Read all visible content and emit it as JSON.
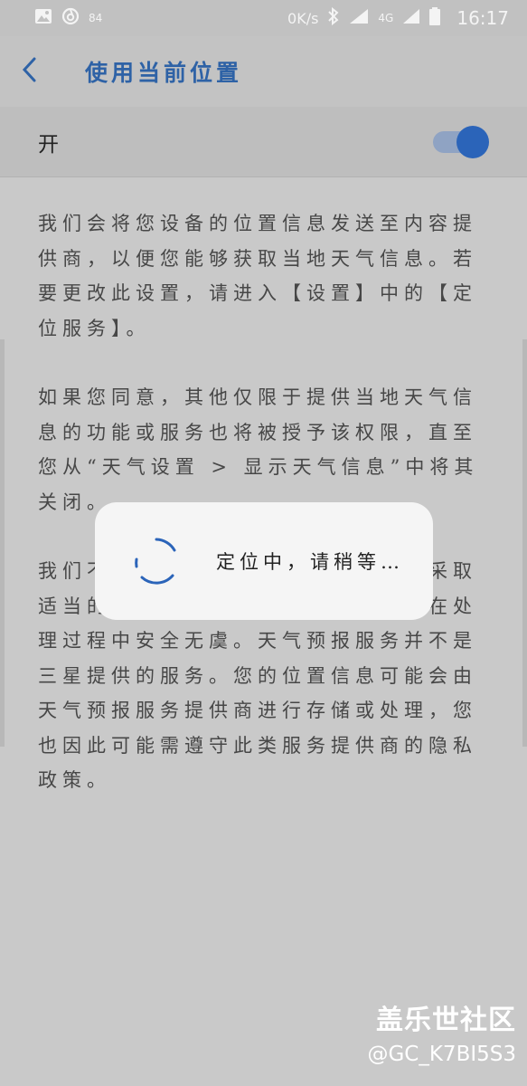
{
  "status_bar": {
    "notification_badge": "84",
    "network_speed": "0K/s",
    "network_type": "4G",
    "time": "16:17"
  },
  "header": {
    "title": "使用当前位置"
  },
  "switch": {
    "label": "开",
    "on": true
  },
  "body": {
    "paragraph1": "我们会将您设备的位置信息发送至内容提供商，以便您能够获取当地天气信息。若要更改此设置，请进入【设置】中的【定位服务】。",
    "paragraph2": "如果您同意，其他仅限于提供当地天气信息的功能或服务也将被授予该权限，直至您从“天气设置 > 显示天气信息”中将其关闭。",
    "paragraph3": "我们不会对您的信息进行保存，并将采取适当的安全措施，确保您的位置信息在处理过程中安全无虞。天气预报服务并不是三星提供的服务。您的位置信息可能会由天气预报服务提供商进行存储或处理，您也因此可能需遵守此类服务提供商的隐私政策。"
  },
  "dialog": {
    "message": "定位中，请稍等…"
  },
  "watermark": {
    "title": "盖乐世社区",
    "user": "@GC_K7BI5S3"
  },
  "colors": {
    "accent": "#2b64b9",
    "title": "#2e62a6",
    "background": "#c9c9c9"
  }
}
